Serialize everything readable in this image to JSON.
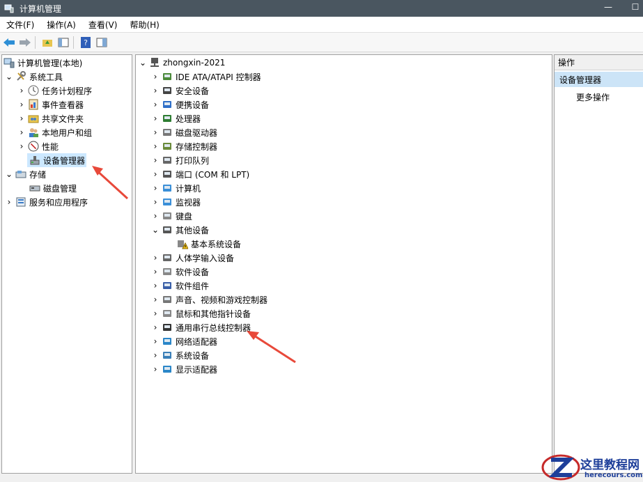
{
  "window": {
    "title": "计算机管理"
  },
  "menu": [
    "文件(F)",
    "操作(A)",
    "查看(V)",
    "帮助(H)"
  ],
  "left_tree": {
    "root": "计算机管理(本地)",
    "system_tools": "系统工具",
    "task_scheduler": "任务计划程序",
    "event_viewer": "事件查看器",
    "shared_folders": "共享文件夹",
    "local_users": "本地用户和组",
    "performance": "性能",
    "device_manager": "设备管理器",
    "storage": "存储",
    "disk_management": "磁盘管理",
    "services_apps": "服务和应用程序"
  },
  "device_tree": {
    "computer_name": "zhongxin-2021",
    "categories": [
      {
        "label": "IDE ATA/ATAPI 控制器",
        "icon": "ide-controller-icon"
      },
      {
        "label": "安全设备",
        "icon": "security-device-icon"
      },
      {
        "label": "便携设备",
        "icon": "portable-device-icon"
      },
      {
        "label": "处理器",
        "icon": "processor-icon"
      },
      {
        "label": "磁盘驱动器",
        "icon": "disk-drive-icon"
      },
      {
        "label": "存储控制器",
        "icon": "storage-controller-icon"
      },
      {
        "label": "打印队列",
        "icon": "printer-icon"
      },
      {
        "label": "端口 (COM 和 LPT)",
        "icon": "port-icon"
      },
      {
        "label": "计算机",
        "icon": "computer-icon"
      },
      {
        "label": "监视器",
        "icon": "monitor-icon"
      },
      {
        "label": "键盘",
        "icon": "keyboard-icon"
      },
      {
        "label": "其他设备",
        "icon": "other-devices-icon"
      },
      {
        "label": "人体学输入设备",
        "icon": "hid-icon"
      },
      {
        "label": "软件设备",
        "icon": "software-device-icon"
      },
      {
        "label": "软件组件",
        "icon": "software-component-icon"
      },
      {
        "label": "声音、视频和游戏控制器",
        "icon": "sound-icon"
      },
      {
        "label": "鼠标和其他指针设备",
        "icon": "mouse-icon"
      },
      {
        "label": "通用串行总线控制器",
        "icon": "usb-icon"
      },
      {
        "label": "网络适配器",
        "icon": "network-adapter-icon"
      },
      {
        "label": "系统设备",
        "icon": "system-device-icon"
      },
      {
        "label": "显示适配器",
        "icon": "display-adapter-icon"
      }
    ],
    "other_child": "基本系统设备"
  },
  "actions": {
    "header": "操作",
    "selected": "设备管理器",
    "more": "更多操作"
  },
  "watermark": {
    "brand": "这里教程网",
    "url": "herecours.com"
  },
  "colors": {
    "titlebar": "#4a5660",
    "selection": "#cce8ff",
    "arrow": "#e8493a"
  }
}
